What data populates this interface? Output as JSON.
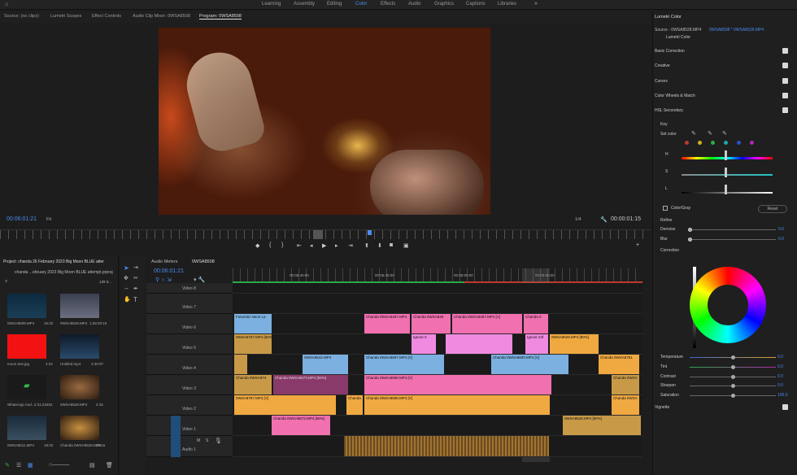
{
  "workspaces": [
    "Learning",
    "Assembly",
    "Editing",
    "Color",
    "Effects",
    "Audio",
    "Graphics",
    "Captions",
    "Libraries"
  ],
  "active_workspace": "Color",
  "panel_tabs": [
    "Source: (no clips)",
    "Lumetri Scopes",
    "Effect Controls",
    "Audio Clip Mixer: 0WSA8508",
    "Program: 0WSA8508"
  ],
  "program": {
    "timecode": "00:06:01:21",
    "fit": "Fit",
    "quality": "1/4",
    "duration": "00:00:01:15"
  },
  "project": {
    "title": "Project: chanda 26 February 2023 Big Moon BLUE atter",
    "path": "chanda ...ebruary 2023 Big Moon BLUE attempt.prproj",
    "count": "139 It...",
    "items": [
      {
        "name": "0WSA8508.MP4",
        "dur": "16:22"
      },
      {
        "name": "0WSA8528.MP4",
        "dur": "1:28:00:15"
      },
      {
        "name": "moon test.jpg",
        "dur": "4:24"
      },
      {
        "name": "Untitled.mp4",
        "dur": "4:40:07"
      },
      {
        "name": "WhatsApp Aud...",
        "dur": "2:31:23452"
      },
      {
        "name": "0WSA8528.MP4",
        "dur": "4:15"
      },
      {
        "name": "0WSA8511.MP4",
        "dur": "18:22"
      },
      {
        "name": "Chanda 0WSA8528.MP4",
        "dur": "19:16"
      }
    ]
  },
  "timeline": {
    "audio_meters": "Audio Meters",
    "seq_tab": "0WSA8508",
    "timecode": "00:06:01:21",
    "ruler": [
      "00:05:40:00",
      "00:05:45:00",
      "00:05:50:00",
      "00:05:55:00"
    ],
    "tracks": [
      {
        "id": "V8",
        "name": "Video 8"
      },
      {
        "id": "V7",
        "name": "Video 7"
      },
      {
        "id": "V6",
        "name": "Video 6"
      },
      {
        "id": "V5",
        "name": "Video 5"
      },
      {
        "id": "V4",
        "name": "Video 4"
      },
      {
        "id": "V3",
        "name": "Video 3"
      },
      {
        "id": "V2",
        "name": "Video 2"
      },
      {
        "id": "V1",
        "name": "Video 1"
      },
      {
        "id": "A1",
        "name": "Audio 1"
      }
    ],
    "clips": {
      "v6": [
        "Futuristic Neon La",
        "Chanda 0WSA8497.MP4",
        "Chanda 0WSA849",
        "Chanda 0WSA8497.MP4 [V]",
        "Chanda 0"
      ],
      "v5": [
        "0WSA8767.MP4 [60%]",
        "Ignore 0",
        "Ignore 24f",
        "0WSA8528.MP4 [80%]"
      ],
      "v4": [
        "0WSA8542.MP4",
        "Chanda 0WSA8697.MP4 [V]",
        "Chanda 0WSA8600.MP4 [V]",
        "Chanda 0WSA8781"
      ],
      "v3": [
        "Chanda 0WSA874",
        "Chanda 0WSA8673.MP4 [55%]",
        "Chanda 0WSA8696.MP4 [V]",
        "Chanda 0WSA"
      ],
      "v2": [
        "0WSA8767.MP4 [V]",
        "Chanda",
        "Chanda 0WSA8696.MP4 [V]",
        "Chanda 0WSA"
      ],
      "v1": [
        "Chanda 0WSA8673.MP4 [55%]",
        "0WSA8528.MP4 [80%]"
      ]
    }
  },
  "lumetri": {
    "title": "Lumetri Color",
    "source": "Source - 0WSA8528.MP4",
    "seq": "0WSA8508 * 0WSA8528.MP4",
    "preset": "Lumetri Color",
    "sections": [
      "Basic Correction",
      "Creative",
      "Curves",
      "Color Wheels & Match",
      "HSL Secondary"
    ],
    "key": "Key",
    "set_color": "Set color",
    "hsl": [
      "H",
      "S",
      "L"
    ],
    "color_gray": "Color/Gray",
    "reset": "Reset",
    "refine": "Refine",
    "denoise": "Denoise",
    "denoise_val": "0.0",
    "blur": "Blur",
    "blur_val": "0.0",
    "correction": "Correction",
    "sliders": [
      {
        "label": "Temperature",
        "value": "0.0"
      },
      {
        "label": "Tint",
        "value": "0.0"
      },
      {
        "label": "Contrast",
        "value": "0.0"
      },
      {
        "label": "Sharpen",
        "value": "0.0"
      },
      {
        "label": "Saturation",
        "value": "100.0"
      }
    ],
    "vignette": "Vignette",
    "swatches": [
      "#c0392b",
      "#d4b020",
      "#2eae3e",
      "#21a6a6",
      "#2a4fd0",
      "#b02ab0"
    ]
  }
}
